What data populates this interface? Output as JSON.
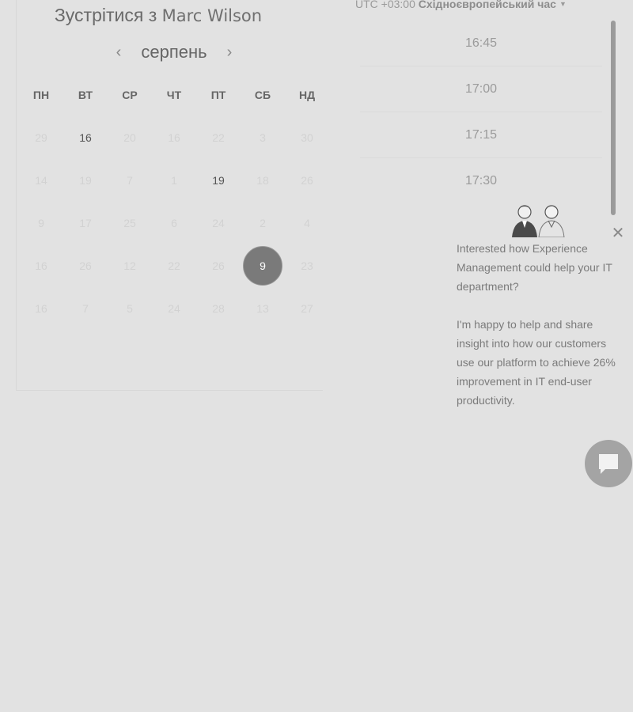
{
  "header": {
    "title_prefix": "Зустрітися з",
    "host_name": "Marc Wilson"
  },
  "calendar": {
    "month": "серпень",
    "weekdays": [
      "ПН",
      "ВТ",
      "СР",
      "ЧТ",
      "ПТ",
      "СБ",
      "НД"
    ],
    "days": [
      {
        "d": "29",
        "state": "disabled"
      },
      {
        "d": "16",
        "state": "available"
      },
      {
        "d": "20",
        "state": "disabled"
      },
      {
        "d": "16",
        "state": "disabled"
      },
      {
        "d": "22",
        "state": "disabled"
      },
      {
        "d": "3",
        "state": "disabled"
      },
      {
        "d": "30",
        "state": "disabled"
      },
      {
        "d": "14",
        "state": "disabled"
      },
      {
        "d": "19",
        "state": "disabled"
      },
      {
        "d": "7",
        "state": "disabled"
      },
      {
        "d": "1",
        "state": "disabled"
      },
      {
        "d": "19",
        "state": "available"
      },
      {
        "d": "18",
        "state": "disabled"
      },
      {
        "d": "26",
        "state": "disabled"
      },
      {
        "d": "9",
        "state": "disabled"
      },
      {
        "d": "17",
        "state": "disabled"
      },
      {
        "d": "25",
        "state": "disabled"
      },
      {
        "d": "6",
        "state": "disabled"
      },
      {
        "d": "24",
        "state": "disabled"
      },
      {
        "d": "2",
        "state": "disabled"
      },
      {
        "d": "4",
        "state": "disabled"
      },
      {
        "d": "16",
        "state": "disabled"
      },
      {
        "d": "26",
        "state": "disabled"
      },
      {
        "d": "12",
        "state": "disabled"
      },
      {
        "d": "22",
        "state": "disabled"
      },
      {
        "d": "26",
        "state": "disabled"
      },
      {
        "d": "9",
        "state": "selected"
      },
      {
        "d": "23",
        "state": "disabled"
      },
      {
        "d": "16",
        "state": "disabled"
      },
      {
        "d": "7",
        "state": "disabled"
      },
      {
        "d": "5",
        "state": "disabled"
      },
      {
        "d": "24",
        "state": "disabled"
      },
      {
        "d": "28",
        "state": "disabled"
      },
      {
        "d": "13",
        "state": "disabled"
      },
      {
        "d": "27",
        "state": "disabled"
      }
    ]
  },
  "timezone": {
    "offset": "UTC +03:00",
    "name": "Східноєвропейський час"
  },
  "slots": [
    "16:45",
    "17:00",
    "17:15",
    "17:30"
  ],
  "chat": {
    "message_1": "Interested how Experience Management could help your IT department?",
    "message_2": "I'm happy to help and share insight into how our customers use our platform to achieve 26% improvement in IT end-user productivity."
  },
  "colors": {
    "background": "#e2e2e2",
    "selected_day": "#7a7a7a",
    "scrollbar": "#9a9a9a",
    "launcher": "#a4a4a4"
  }
}
